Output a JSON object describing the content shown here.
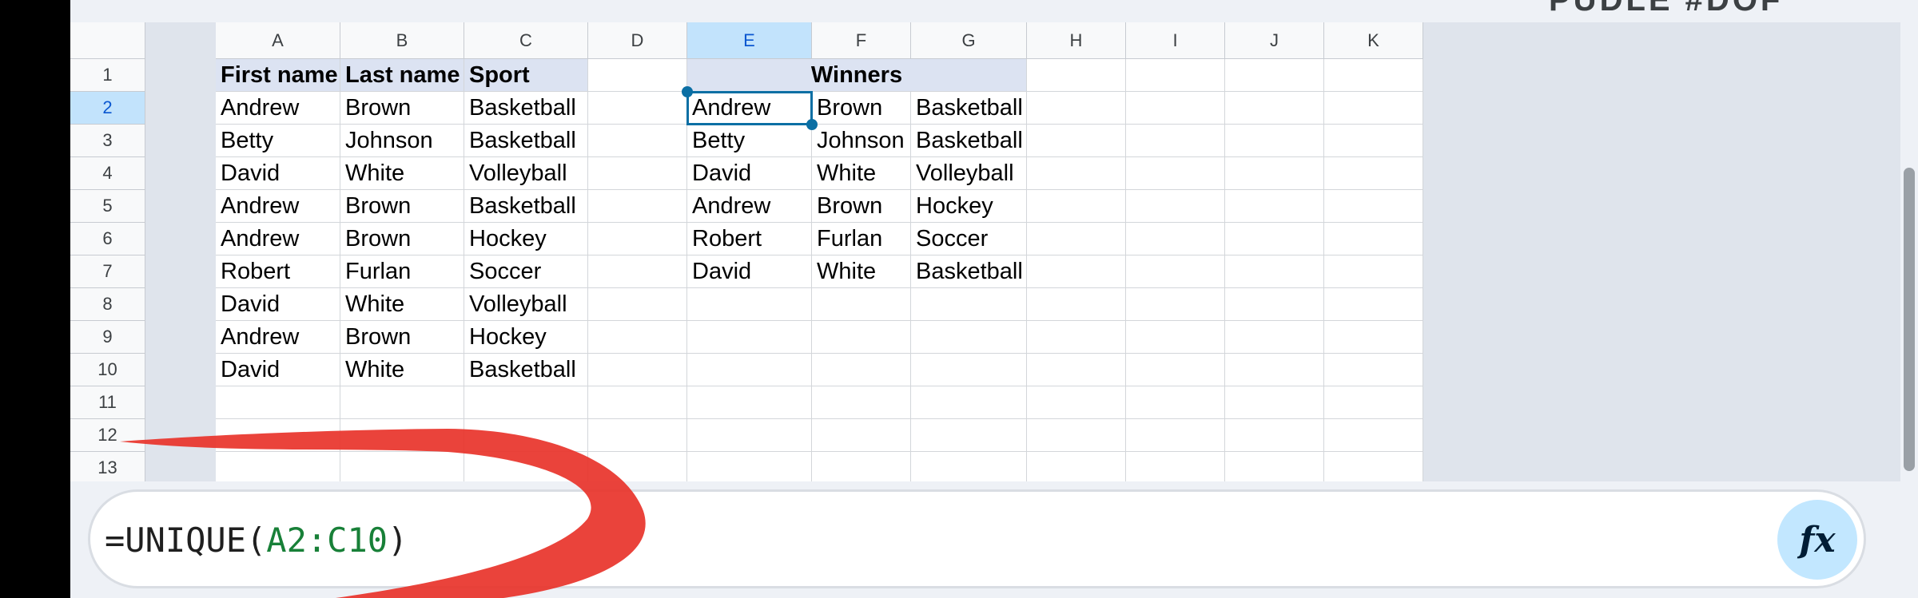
{
  "top_partial_text": "PUDLE #DOF",
  "columns": [
    "A",
    "B",
    "C",
    "D",
    "E",
    "F",
    "G",
    "H",
    "I",
    "J",
    "K"
  ],
  "selected_column": "E",
  "rows": [
    "1",
    "2",
    "3",
    "4",
    "5",
    "6",
    "7",
    "8",
    "9",
    "10",
    "11",
    "12",
    "13"
  ],
  "selected_row": "2",
  "headers": {
    "first_name": "First name",
    "last_name": "Last name",
    "sport": "Sport",
    "winners": "Winners"
  },
  "source_data": [
    [
      "Andrew",
      "Brown",
      "Basketball"
    ],
    [
      "Betty",
      "Johnson",
      "Basketball"
    ],
    [
      "David",
      "White",
      "Volleyball"
    ],
    [
      "Andrew",
      "Brown",
      "Basketball"
    ],
    [
      "Andrew",
      "Brown",
      "Hockey"
    ],
    [
      "Robert",
      "Furlan",
      "Soccer"
    ],
    [
      "David",
      "White",
      "Volleyball"
    ],
    [
      "Andrew",
      "Brown",
      "Hockey"
    ],
    [
      "David",
      "White",
      "Basketball"
    ]
  ],
  "winners_data": [
    [
      "Andrew",
      "Brown",
      "Basketball"
    ],
    [
      "Betty",
      "Johnson",
      "Basketball"
    ],
    [
      "David",
      "White",
      "Volleyball"
    ],
    [
      "Andrew",
      "Brown",
      "Hockey"
    ],
    [
      "Robert",
      "Furlan",
      "Soccer"
    ],
    [
      "David",
      "White",
      "Basketball"
    ]
  ],
  "formula": {
    "prefix": "=UNIQUE(",
    "range": "A2:C10",
    "suffix": ")"
  },
  "fx_label": "fx",
  "active_cell": "E2",
  "colors": {
    "accent": "#0b6fa4",
    "formula_range": "#188038",
    "annotation": "#e8332a"
  },
  "icons": [
    "fx-icon"
  ]
}
